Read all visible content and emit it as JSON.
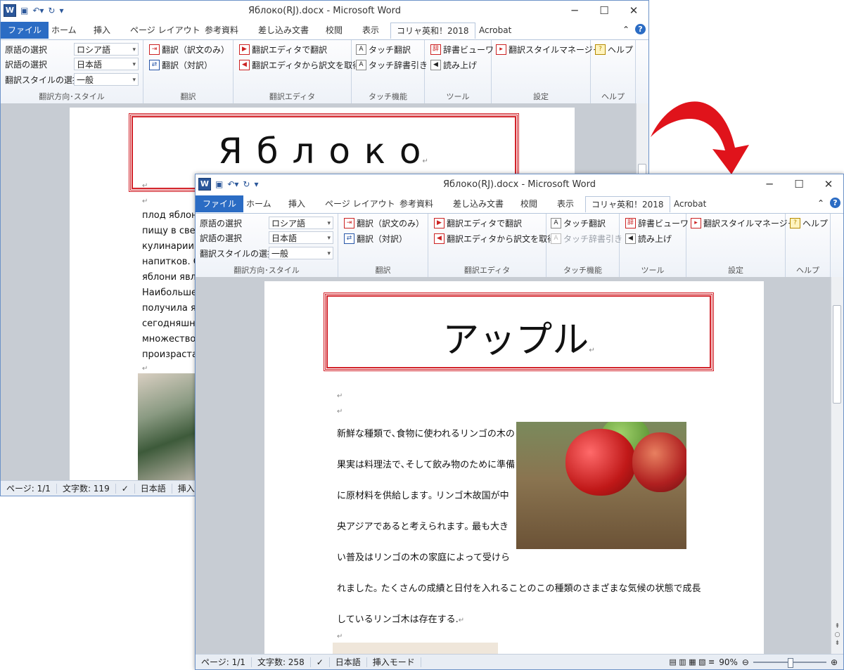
{
  "colors": {
    "accent": "#2b6cc4",
    "title_border": "#d2232a",
    "arrow": "#e0131b"
  },
  "qat_icons": [
    "word-icon",
    "save-icon",
    "undo-icon",
    "redo-icon",
    "customize-icon"
  ],
  "tabs": [
    "ファイル",
    "ホーム",
    "挿入",
    "ページ レイアウト",
    "参考資料",
    "差し込み文書",
    "校閲",
    "表示",
    "コリャ英和！2018",
    "Acrobat"
  ],
  "active_tab": "コリャ英和！2018",
  "ribbon": {
    "direction_group": {
      "label": "翻訳方向･スタイル",
      "source_label": "原語の選択",
      "source_value": "ロシア語",
      "target_label": "訳語の選択",
      "target_value": "日本語",
      "style_label": "翻訳スタイルの選択",
      "style_value": "一般"
    },
    "translate_group": {
      "label": "翻訳",
      "btn1": "翻訳（訳文のみ）",
      "btn2": "翻訳（対訳）"
    },
    "editor_group": {
      "label": "翻訳エディタ",
      "btn1": "翻訳エディタで翻訳",
      "btn2": "翻訳エディタから訳文を取得"
    },
    "touch_group": {
      "label": "タッチ機能",
      "btn1": "タッチ翻訳",
      "btn2_back": "タッチ辞書引き",
      "btn2_front": "タッチ辞書引き"
    },
    "tools_group": {
      "label": "ツール",
      "btn1": "辞書ビューワ",
      "btn2": "読み上げ"
    },
    "settings_group": {
      "label": "設定",
      "btn1": "翻訳スタイルマネージャ"
    },
    "help_group": {
      "label": "ヘルプ",
      "btn1": "ヘルプ"
    }
  },
  "back_window": {
    "title": "Яблоко(RJ).docx - Microsoft Word",
    "doc_title": "Я б л о к о",
    "paragraph_lines": [
      "плод яблони",
      "пищу в свеж",
      "кулинарии и",
      "напитков. Ср",
      "яблони явля",
      "Наибольшее",
      "получила яб",
      "сегодняшни",
      "множество с",
      "произрастак"
    ],
    "status": {
      "page": "ページ: 1/1",
      "words": "文字数: 119",
      "language": "日本語",
      "mode": "挿入"
    }
  },
  "front_window": {
    "title": "Яблоко(RJ).docx - Microsoft Word",
    "doc_title": "アップル",
    "paragraph_lines": [
      "新鮮な種類で､食物に使われるリンゴの木の",
      "果実は料理法で､そして飲み物のために準備",
      "に原材料を供給します｡ リンゴ木故国が中",
      "央アジアであると考えられます｡ 最も大き",
      "い普及はリンゴの木の家庭によって受けら",
      "れました｡ たくさんの成績と日付を入れることのこの種類のさまざまな気候の状態で成長",
      "しているリンゴ木は存在する."
    ],
    "status": {
      "page": "ページ: 1/1",
      "words": "文字数: 258",
      "language": "日本語",
      "mode": "挿入モード",
      "zoom": "90%"
    },
    "zoom_level": 0.5
  },
  "window_controls": {
    "minimize": "─",
    "maximize": "☐",
    "close": "✕"
  },
  "help_symbol": "?",
  "collapse_symbol": "⌃"
}
